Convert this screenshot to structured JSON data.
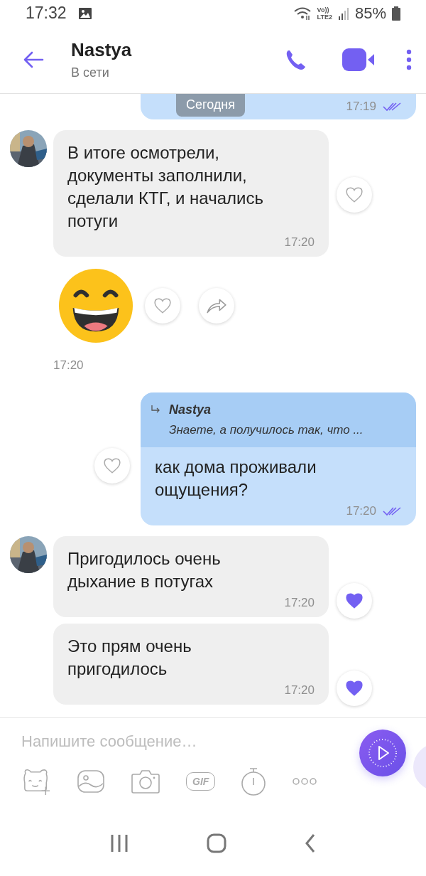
{
  "status_bar": {
    "time": "17:32",
    "network_top": "Vo))",
    "network_bottom": "LTE2",
    "battery": "85%"
  },
  "header": {
    "name": "Nastya",
    "status": "В сети"
  },
  "date_chip": "Сегодня",
  "messages": [
    {
      "kind": "outgoing",
      "time": "17:19",
      "read": true
    },
    {
      "kind": "incoming",
      "avatar": true,
      "text": "В итоге осмотрели, документы заполнили, сделали КТГ, и начались потуги",
      "time": "17:20",
      "liked": false
    },
    {
      "kind": "sticker",
      "time": "17:20",
      "liked": false
    },
    {
      "kind": "outgoing",
      "reply": {
        "name": "Nastya",
        "text": "Знаете, а получилось так, что ..."
      },
      "text": "как дома проживали ощущения?",
      "time": "17:20",
      "read": true,
      "liked": false
    },
    {
      "kind": "incoming",
      "avatar": true,
      "text": "Пригодилось очень дыхание в потугах",
      "time": "17:20",
      "liked": true
    },
    {
      "kind": "incoming",
      "avatar": false,
      "text": "Это прям очень пригодилось",
      "time": "17:20",
      "liked": true
    }
  ],
  "composer": {
    "placeholder": "Напишите сообщение…",
    "gif_label": "GIF"
  }
}
